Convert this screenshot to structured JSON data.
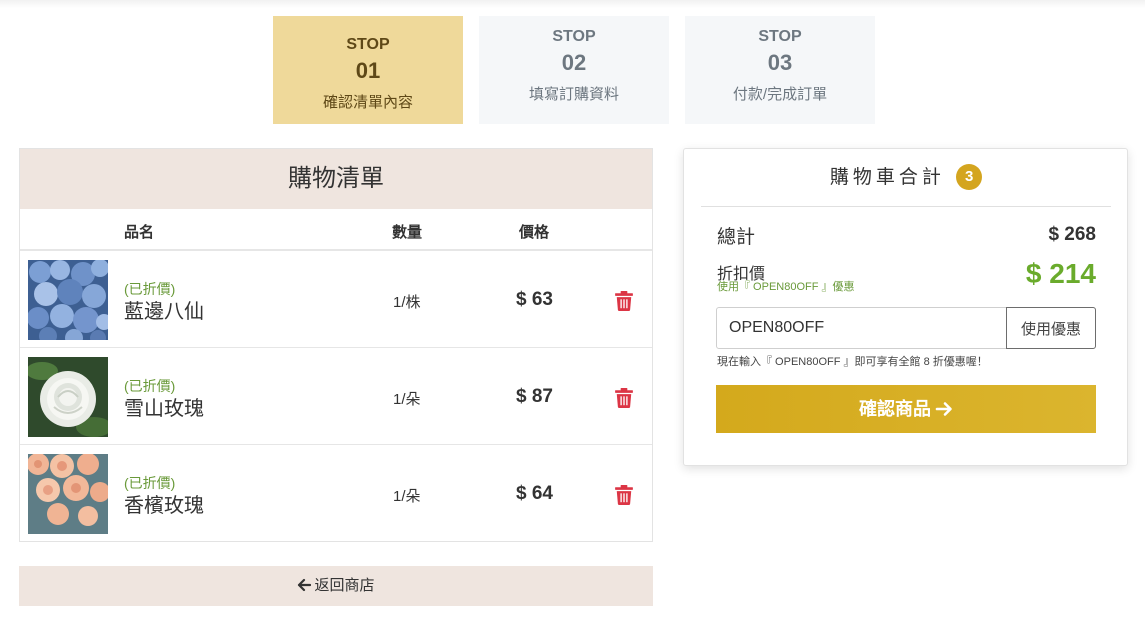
{
  "steps": [
    {
      "label": "STOP",
      "num": "01",
      "text": "確認清單內容",
      "active": true
    },
    {
      "label": "STOP",
      "num": "02",
      "text": "填寫訂購資料",
      "active": false
    },
    {
      "label": "STOP",
      "num": "03",
      "text": "付款/完成訂單",
      "active": false
    }
  ],
  "cart": {
    "title": "購物清單",
    "headers": {
      "name": "品名",
      "qty": "數量",
      "price": "價格"
    },
    "items": [
      {
        "tag": "(已折價)",
        "name": "藍邊八仙",
        "qty": "1/株",
        "price": "$ 63",
        "image": "hydrangea-photo"
      },
      {
        "tag": "(已折價)",
        "name": "雪山玫瑰",
        "qty": "1/朵",
        "price": "$ 87",
        "image": "white-rose-photo"
      },
      {
        "tag": "(已折價)",
        "name": "香檳玫瑰",
        "qty": "1/朵",
        "price": "$ 64",
        "image": "champagne-rose-photo"
      }
    ],
    "back_label": "返回商店"
  },
  "summary": {
    "title": "購物車合計",
    "count": "3",
    "total_label": "總計",
    "total_value": "$ 268",
    "discount_label": "折扣價",
    "discount_note": "使用『 OPEN80OFF 』優惠",
    "discount_value": "$ 214",
    "coupon_value": "OPEN80OFF",
    "coupon_button": "使用優惠",
    "hint": "現在輸入『 OPEN80OFF 』即可享有全館 8 折優惠喔！",
    "confirm_label": "確認商品"
  },
  "colors": {
    "step_active": "#efd99a",
    "accent_gold": "#d4a51f",
    "discount_green": "#6aab2c",
    "trash_red": "#dc3545"
  }
}
